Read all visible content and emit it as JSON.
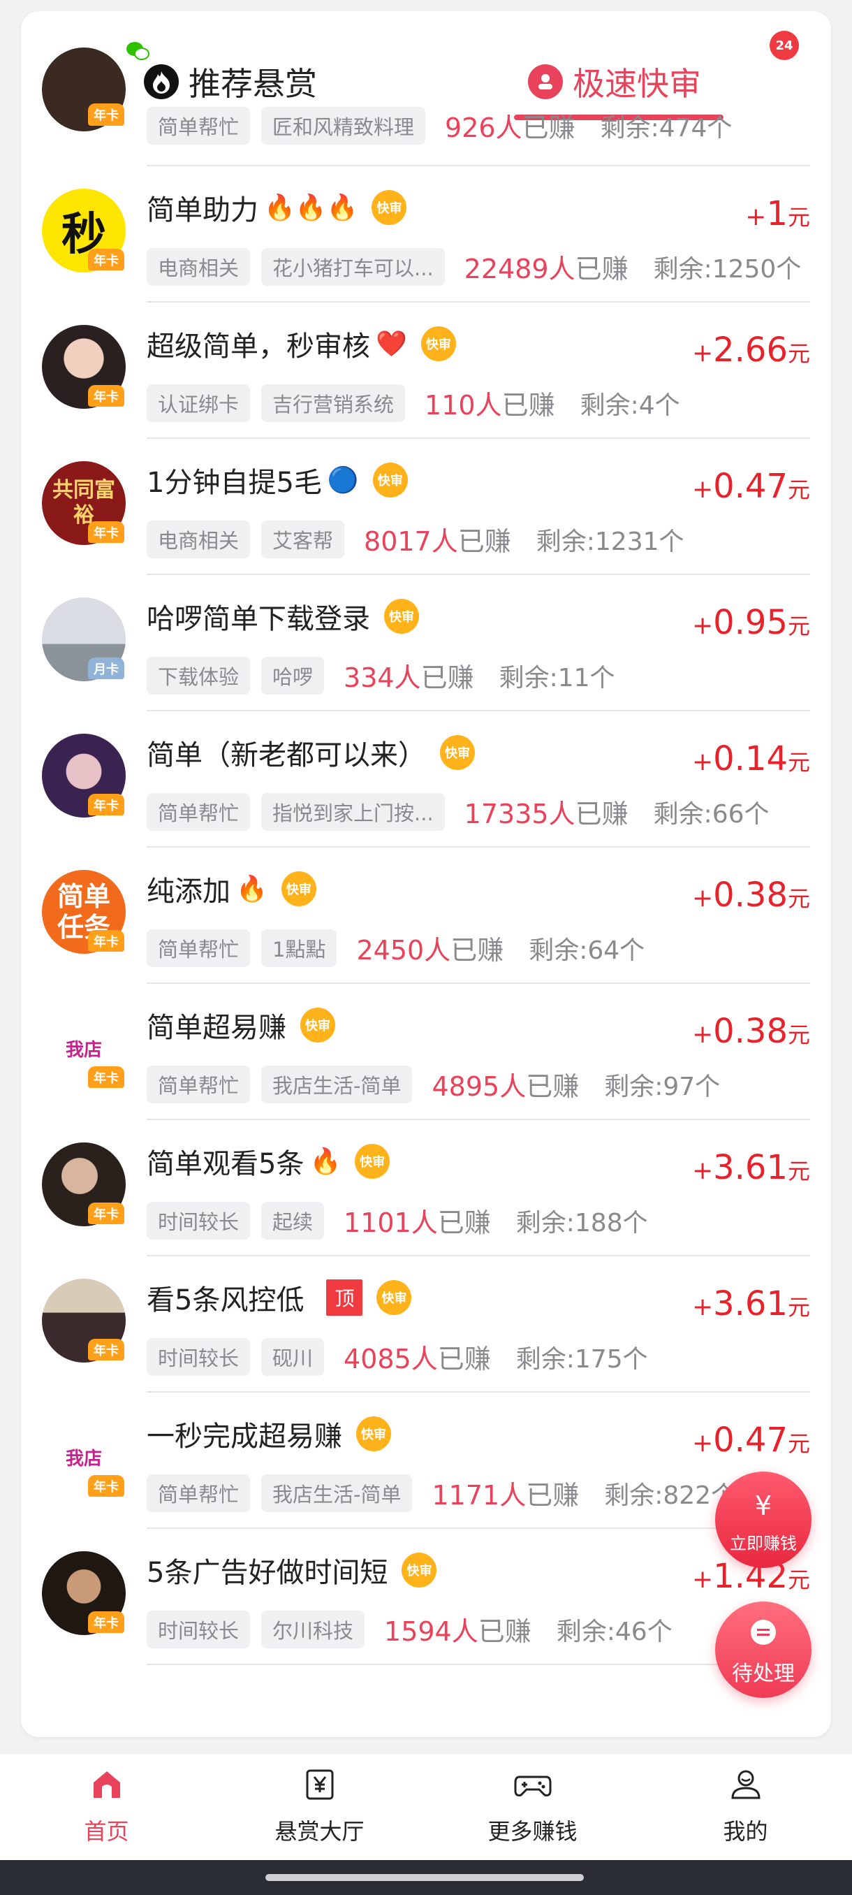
{
  "header": {
    "corner_badge": "24",
    "tab_recommend": "推荐悬赏",
    "tab_fast": "极速快审"
  },
  "partial_row": {
    "tag1": "简单帮忙",
    "tag2": "匠和风精致料理",
    "earned": "926人",
    "earned_label": "已赚",
    "remain": "剩余:474个",
    "vip": "年卡"
  },
  "tasks": [
    {
      "title": "简单助力",
      "emoji": "🔥🔥🔥",
      "fast": "快审",
      "top": "",
      "reward": "1",
      "tag1": "电商相关",
      "tag2": "花小猪打车可以...",
      "earned": "22489人",
      "remain": "剩余:1250个",
      "avatar_text": "秒",
      "vip": "年卡"
    },
    {
      "title": "超级简单，秒审核",
      "emoji": "❤️",
      "fast": "快审",
      "top": "",
      "reward": "2.66",
      "tag1": "认证绑卡",
      "tag2": "吉行营销系统",
      "earned": "110人",
      "remain": "剩余:4个",
      "avatar_text": "",
      "vip": "年卡"
    },
    {
      "title": "1分钟自提5毛",
      "emoji": "🔵",
      "fast": "快审",
      "top": "",
      "reward": "0.47",
      "tag1": "电商相关",
      "tag2": "艾客帮",
      "earned": "8017人",
      "remain": "剩余:1231个",
      "avatar_text": "共同富裕",
      "vip": "年卡"
    },
    {
      "title": "哈啰简单下载登录",
      "emoji": "",
      "fast": "快审",
      "top": "",
      "reward": "0.95",
      "tag1": "下载体验",
      "tag2": "哈啰",
      "earned": "334人",
      "remain": "剩余:11个",
      "avatar_text": "",
      "vip": "月卡"
    },
    {
      "title": "简单（新老都可以来）",
      "emoji": "",
      "fast": "快审",
      "top": "",
      "reward": "0.14",
      "tag1": "简单帮忙",
      "tag2": "指悦到家上门按...",
      "earned": "17335人",
      "remain": "剩余:66个",
      "avatar_text": "",
      "vip": "年卡"
    },
    {
      "title": "纯添加",
      "emoji": "🔥",
      "fast": "快审",
      "top": "",
      "reward": "0.38",
      "tag1": "简单帮忙",
      "tag2": "1點點",
      "earned": "2450人",
      "remain": "剩余:64个",
      "avatar_text": "简单任务",
      "vip": "年卡"
    },
    {
      "title": "简单超易赚",
      "emoji": "",
      "fast": "快审",
      "top": "",
      "reward": "0.38",
      "tag1": "简单帮忙",
      "tag2": "我店生活-简单",
      "earned": "4895人",
      "remain": "剩余:97个",
      "avatar_text": "我店",
      "vip": "年卡"
    },
    {
      "title": "简单观看5条",
      "emoji": "🔥",
      "fast": "快审",
      "top": "",
      "reward": "3.61",
      "tag1": "时间较长",
      "tag2": "起续",
      "earned": "1101人",
      "remain": "剩余:188个",
      "avatar_text": "",
      "vip": "年卡"
    },
    {
      "title": "看5条风控低",
      "emoji": "",
      "fast": "快审",
      "top": "顶",
      "reward": "3.61",
      "tag1": "时间较长",
      "tag2": "砚川",
      "earned": "4085人",
      "remain": "剩余:175个",
      "avatar_text": "",
      "vip": "年卡"
    },
    {
      "title": "一秒完成超易赚",
      "emoji": "",
      "fast": "快审",
      "top": "",
      "reward": "0.47",
      "tag1": "简单帮忙",
      "tag2": "我店生活-简单",
      "earned": "1171人",
      "remain": "剩余:822个",
      "avatar_text": "我店",
      "vip": "年卡"
    },
    {
      "title": "5条广告好做时间短",
      "emoji": "",
      "fast": "快审",
      "top": "",
      "reward": "1.42",
      "tag1": "时间较长",
      "tag2": "尔川科技",
      "earned": "1594人",
      "remain": "剩余:46个",
      "avatar_text": "",
      "vip": "年卡"
    }
  ],
  "common": {
    "plus": "+",
    "unit": "元",
    "earned_label": "已赚"
  },
  "float": {
    "earn_label": "立即赚钱",
    "earn_icon": "¥",
    "pending_label": "待处理"
  },
  "nav": [
    {
      "label": "首页",
      "icon": "home-icon"
    },
    {
      "label": "悬赏大厅",
      "icon": "yuan-board-icon"
    },
    {
      "label": "更多赚钱",
      "icon": "gamepad-icon"
    },
    {
      "label": "我的",
      "icon": "user-icon"
    }
  ],
  "colors": {
    "accent": "#e8435a",
    "reward": "#e8222b",
    "fast_badge": "#ffb21a",
    "vip": "#ff9f1a"
  }
}
